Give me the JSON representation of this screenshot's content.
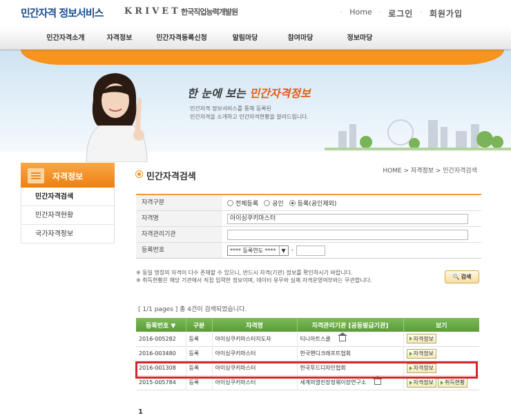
{
  "header": {
    "logo_main": "민간자격 정보서비스",
    "logo_krivet": "KRIVET",
    "logo_org": "한국직업능력개발원",
    "links": [
      "Home",
      "로그인",
      "회원가입"
    ]
  },
  "gnb": [
    "민간자격소개",
    "자격정보",
    "민간자격등록신청",
    "알림마당",
    "참여마당",
    "정보마당"
  ],
  "visual": {
    "slogan_pre": "한 눈에 보는",
    "slogan_hl": "민간자격정보",
    "intro_1": "민간자격 정보서비스를 통해 등록된",
    "intro_2": "민간자격을 소개하고 민간자격현황을 알려드립니다."
  },
  "lnb": {
    "title": "자격정보",
    "items": [
      "민간자격검색",
      "민간자격현황",
      "국가자격정보"
    ]
  },
  "content": {
    "title": "민간자격검색",
    "breadcrumb": [
      "HOME",
      "자격정보",
      "민간자격검색"
    ]
  },
  "search": {
    "type_label": "자격구분",
    "type_options": [
      "전체등록",
      "공인",
      "등록(공인제외)"
    ],
    "type_selected": 2,
    "name_label": "자격명",
    "name_value": "아이싱쿠키마스터",
    "org_label": "자격관리기관",
    "org_value": "",
    "reg_label": "등록번호",
    "reg_select": "**** 등록연도 ****",
    "reg_dash": "-",
    "button": "검색",
    "notice_1": "※ 동일 명칭의 자격이 다수 존재할 수 있으니, 반드시 자격(기관) 정보를 확인하시기 바랍니다.",
    "notice_2": "※ 취득현황은 해당 기관에서 직접 입력한 정보이며, 데이터 유무와 실제 자격운영여부와는 무관합니다."
  },
  "result": {
    "count_text": "[ 1/1 pages ] 총 4건이 검색되었습니다.",
    "columns": [
      "등록번호 ▼",
      "구분",
      "자격명",
      "자격관리기관 [공동발급기관]",
      "보기"
    ],
    "rows": [
      {
        "no": "2016-005282",
        "type": "등록",
        "name": "아이싱쿠키마스터지도자",
        "org": "티니아트스쿨",
        "home": true,
        "buttons": [
          "자격정보"
        ]
      },
      {
        "no": "2016-003480",
        "type": "등록",
        "name": "아이싱쿠키마스터",
        "org": "한국핸디크래프트협회",
        "home": false,
        "buttons": [
          "자격정보"
        ]
      },
      {
        "no": "2016-001308",
        "type": "등록",
        "name": "아이싱쿠키마스터",
        "org": "한국푸드디자인협회",
        "home": false,
        "buttons": [
          "자격정보"
        ]
      },
      {
        "no": "2015-005784",
        "type": "등록",
        "name": "아이싱쿠키마스터",
        "org": "세계의열린장정웨이장연구소",
        "home": true,
        "buttons": [
          "자격정보",
          "취득현황"
        ]
      }
    ],
    "highlighted_row": 2,
    "paging": "1"
  },
  "colors": {
    "orange": "#f7941d",
    "green_header": "#6aab45",
    "highlight_box": "#d7242d"
  }
}
